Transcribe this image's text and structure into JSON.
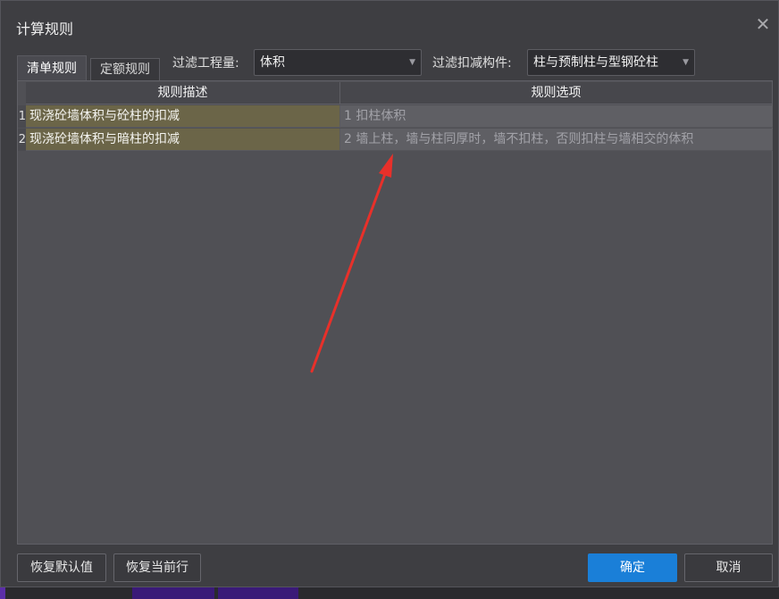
{
  "window": {
    "title": "计算规则"
  },
  "tabs": [
    {
      "label": "清单规则",
      "active": true
    },
    {
      "label": "定额规则",
      "active": false
    }
  ],
  "filters": {
    "quantity_label": "过滤工程量:",
    "quantity_value": "体积",
    "component_label": "过滤扣减构件:",
    "component_value": "柱与预制柱与型钢砼柱"
  },
  "table": {
    "headers": [
      "规则描述",
      "规则选项"
    ],
    "rows": [
      {
        "num": "1",
        "description": "现浇砼墙体积与砼柱的扣减",
        "option": "1  扣柱体积"
      },
      {
        "num": "2",
        "description": "现浇砼墙体积与暗柱的扣减",
        "option": "2  墙上柱，墙与柱同厚时，墙不扣柱，否则扣柱与墙相交的体积"
      }
    ]
  },
  "buttons": {
    "restore_default": "恢复默认值",
    "restore_current_row": "恢复当前行",
    "ok": "确定",
    "cancel": "取消"
  },
  "icons": {
    "close": "close-icon",
    "dropdown": "chevron-down-icon",
    "annotation": "red-arrow-annotation"
  },
  "colors": {
    "accent": "#1a7fd8",
    "arrow": "#e8302a",
    "row_highlight": "#6b6548"
  }
}
